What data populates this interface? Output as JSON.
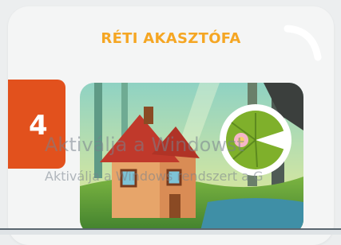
{
  "card": {
    "title": "RÉTI AKASZTÓFA",
    "level_number": "4",
    "accent_color": "#f5a623",
    "badge_color": "#e2511d"
  },
  "artwork": {
    "description_icon": "house-lilypad-illustration"
  },
  "watermark": {
    "line1": "Aktiválja a Windowst",
    "line2": "Aktiválja a Windows rendszert a G"
  }
}
